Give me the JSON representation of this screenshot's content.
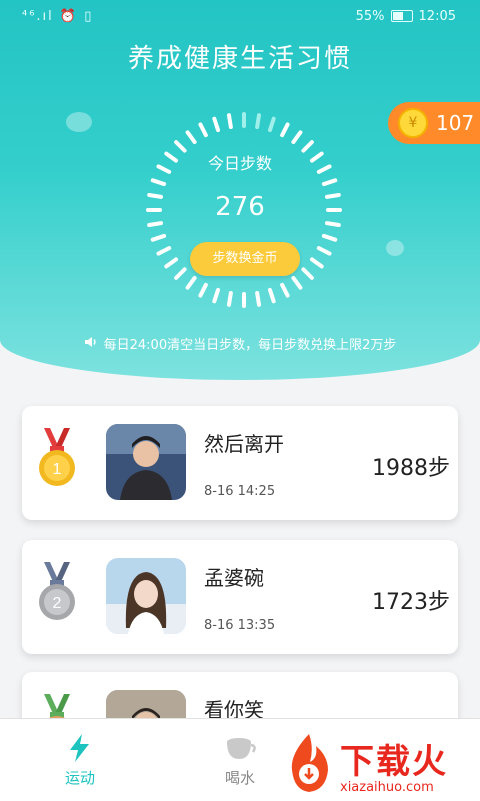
{
  "status_bar": {
    "signal": "⁴⁶.ıl ⏰ ▯",
    "battery": "55%",
    "time": "12:05"
  },
  "header": {
    "title": "养成健康生活习惯"
  },
  "coins": {
    "icon": "coin-icon",
    "icon_glyph": "¥",
    "count": "107"
  },
  "pedometer": {
    "label": "今日步数",
    "value": "276",
    "convert_button": "步数换金币"
  },
  "notice": {
    "icon": "speaker-icon",
    "text": "每日24:00清空当日步数，每日步数兑换上限2万步"
  },
  "ranking": [
    {
      "rank": "1",
      "medal_color": "#f2b820",
      "name": "然后离开",
      "time": "8-16 14:25",
      "steps": "1988步"
    },
    {
      "rank": "2",
      "medal_color": "#a5a7ab",
      "name": "孟婆碗",
      "time": "8-16 13:35",
      "steps": "1723步"
    },
    {
      "rank": "3",
      "medal_color": "#e0a165",
      "name": "看你笑",
      "time": "",
      "steps": ""
    }
  ],
  "tabs": [
    {
      "label": "运动",
      "icon": "lightning-icon",
      "active": true,
      "color": "#1cc3bf"
    },
    {
      "label": "喝水",
      "icon": "cup-icon",
      "active": false,
      "color": "#888888"
    }
  ],
  "watermark": {
    "text": "下载火",
    "url": "xiazaihuo.com"
  }
}
